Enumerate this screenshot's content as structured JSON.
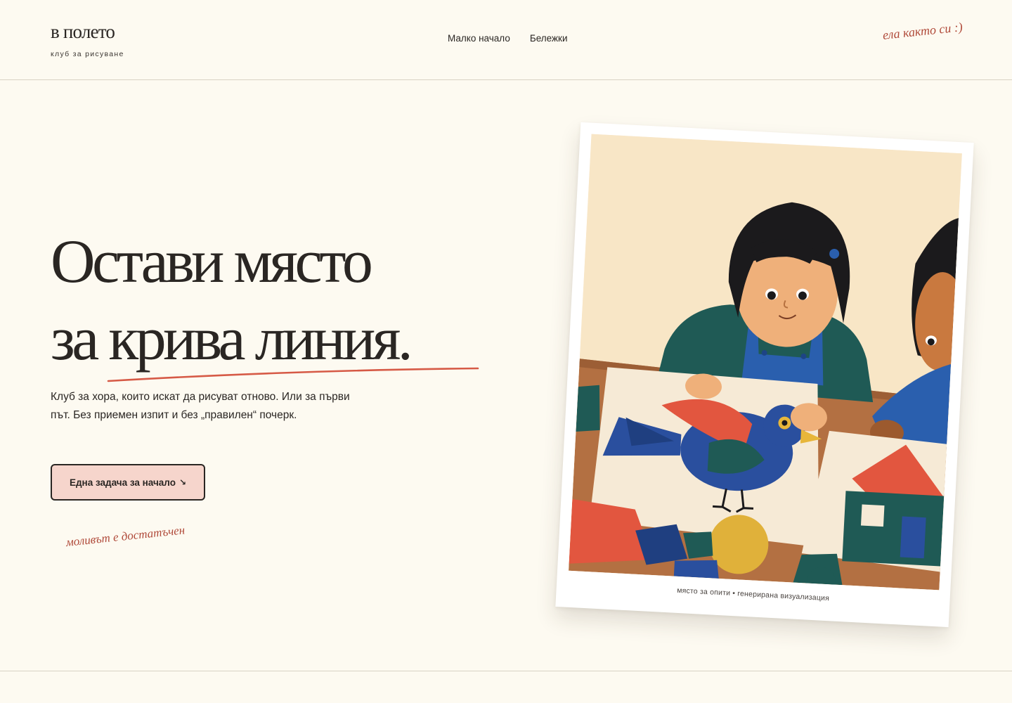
{
  "header": {
    "brand_name": "в полето",
    "brand_tagline": "клуб за рисуване",
    "nav": [
      {
        "label": "Малко начало"
      },
      {
        "label": "Бележки"
      }
    ],
    "handwritten_note": "ела както си :)"
  },
  "hero": {
    "headline_line1": "Остави място",
    "headline_line2": "за крива линия.",
    "description": "Клуб за хора, които искат да рисуват отново. Или за първи път. Без приемен изпит и без „правилен“ почерк.",
    "cta_label": "Една задача за начало",
    "cta_arrow": "↘",
    "handwritten_note": "моливът е достатъчен"
  },
  "illustration": {
    "caption": "място за опити • генерирана визуализация"
  },
  "colors": {
    "background": "#fdfaf1",
    "text": "#2a2623",
    "accent_red": "#d65a46",
    "handwriting": "#b04a3a",
    "cta_fill": "#f6d5cc"
  }
}
